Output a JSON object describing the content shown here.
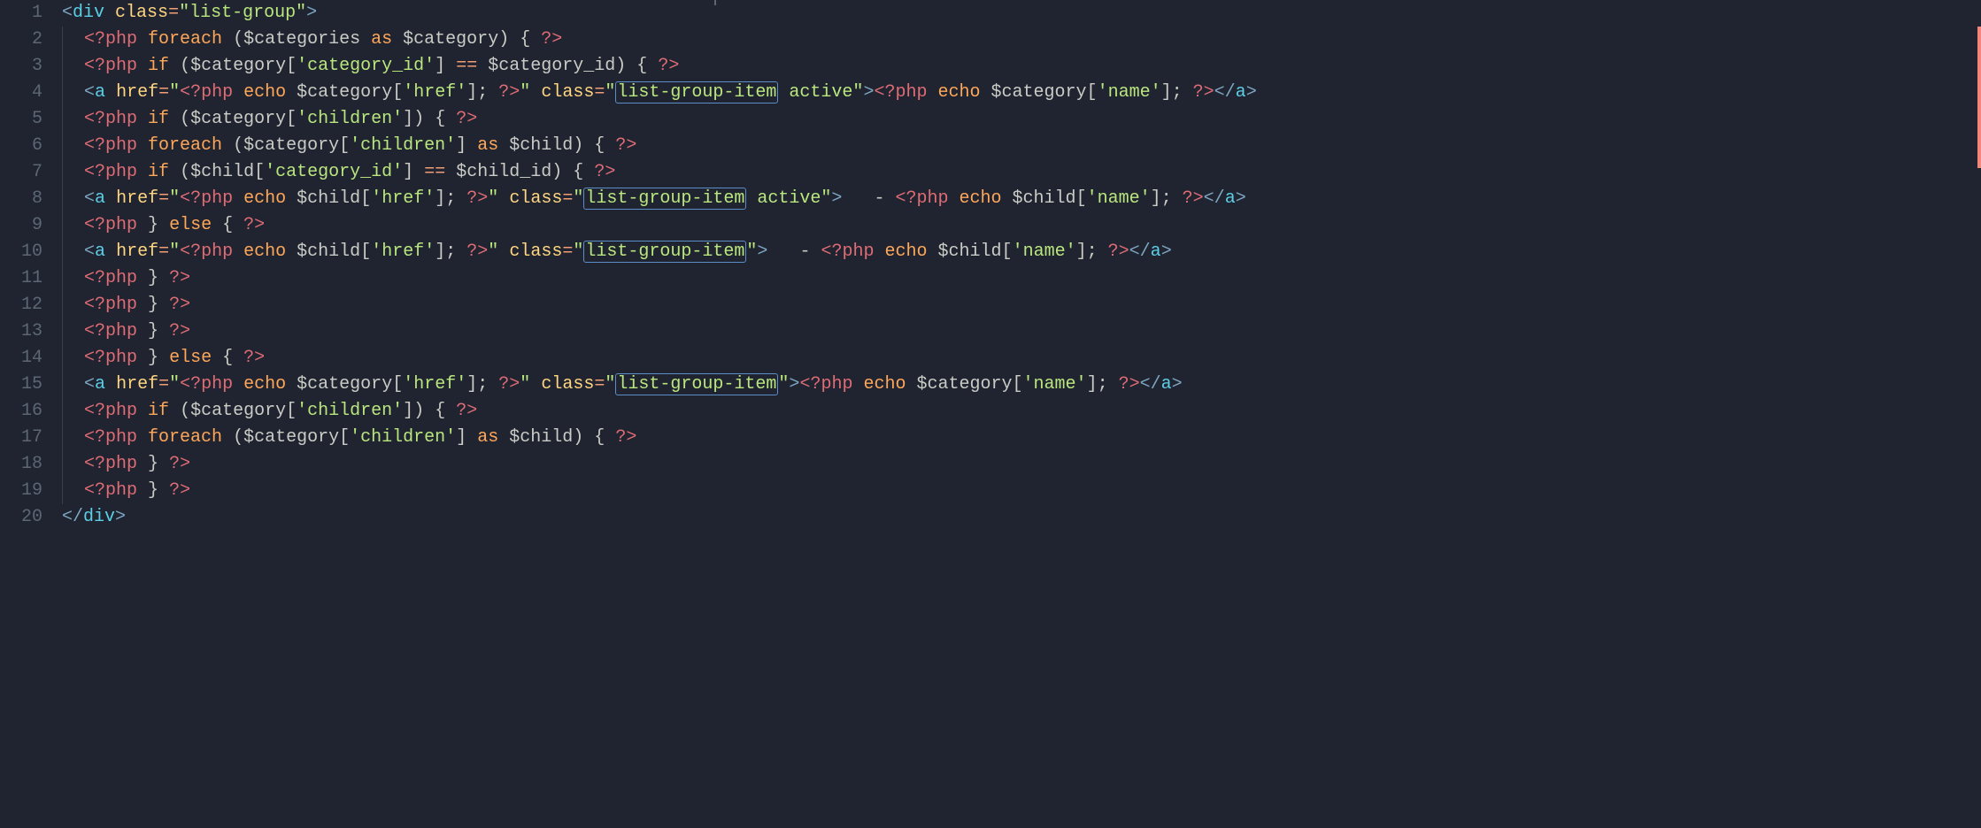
{
  "gutter": {
    "start": 1,
    "end": 20
  },
  "tokens": {
    "div": "div",
    "a": "a",
    "class": "class",
    "href": "href",
    "list_group": "list-group",
    "list_group_item": "list-group-item",
    "active_suffix": " active",
    "php_open": "<?php",
    "php_close": "?>",
    "foreach": "foreach",
    "if": "if",
    "else": "else",
    "as": "as",
    "echo": "echo",
    "var_categories": "$categories",
    "var_category": "$category",
    "var_child": "$child",
    "var_category_id": "$category_id",
    "var_child_id": "$child_id",
    "key_category_id": "'category_id'",
    "key_href": "'href'",
    "key_children": "'children'",
    "key_name": "'name'",
    "dash": "-",
    "op_eqeq": "=="
  }
}
